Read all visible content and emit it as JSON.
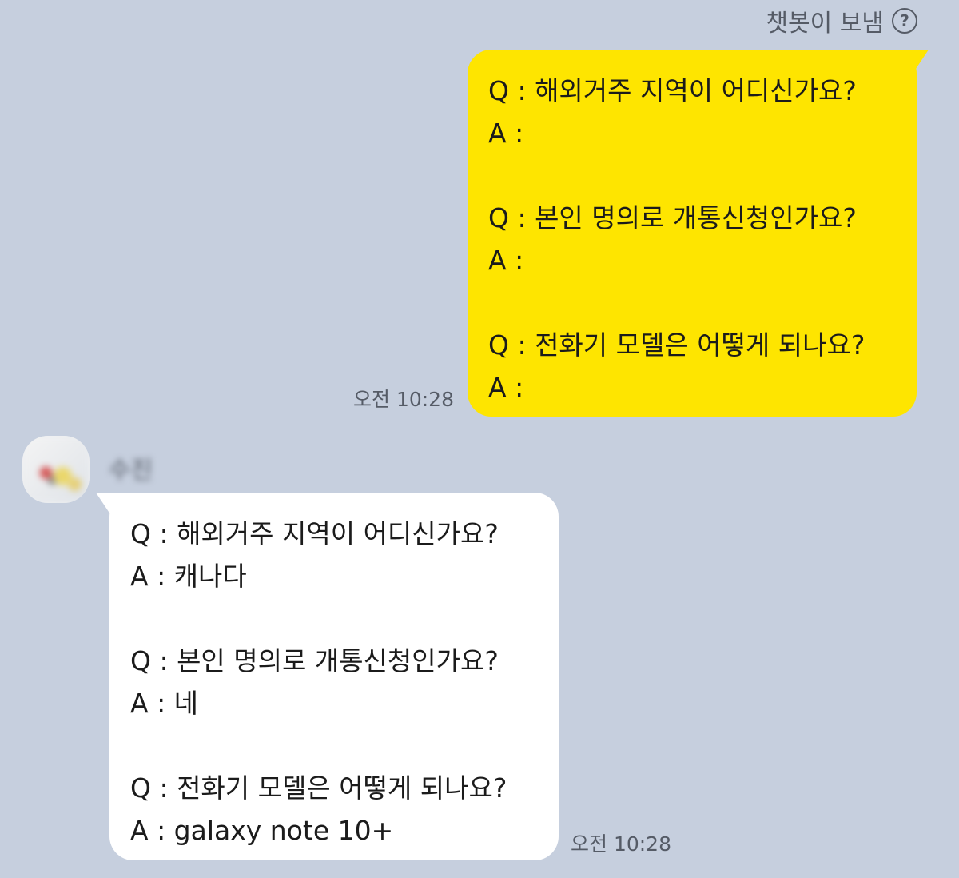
{
  "header": {
    "sent_by_label": "챗봇이 보냄",
    "help_icon": "question-circle-icon"
  },
  "outgoing_message": {
    "time": "오전 10:28",
    "lines": [
      "Q : 해외거주 지역이 어디신가요?",
      "A :",
      "Q : 본인 명의로 개통신청인가요?",
      "A :",
      "Q : 전화기 모델은 어떻게 되나요?",
      "A :"
    ]
  },
  "incoming_message": {
    "sender_name": "수진",
    "time": "오전 10:28",
    "lines": [
      "Q : 해외거주 지역이 어디신가요?",
      "A : 캐나다",
      "Q : 본인 명의로 개통신청인가요?",
      "A : 네",
      "Q : 전화기 모델은 어떻게 되나요?",
      "A : galaxy note 10+"
    ]
  },
  "colors": {
    "background": "#c6cfde",
    "outgoing_bubble": "#fee500",
    "incoming_bubble": "#ffffff",
    "meta_text": "#555b66",
    "message_text": "#1b1b1b"
  }
}
